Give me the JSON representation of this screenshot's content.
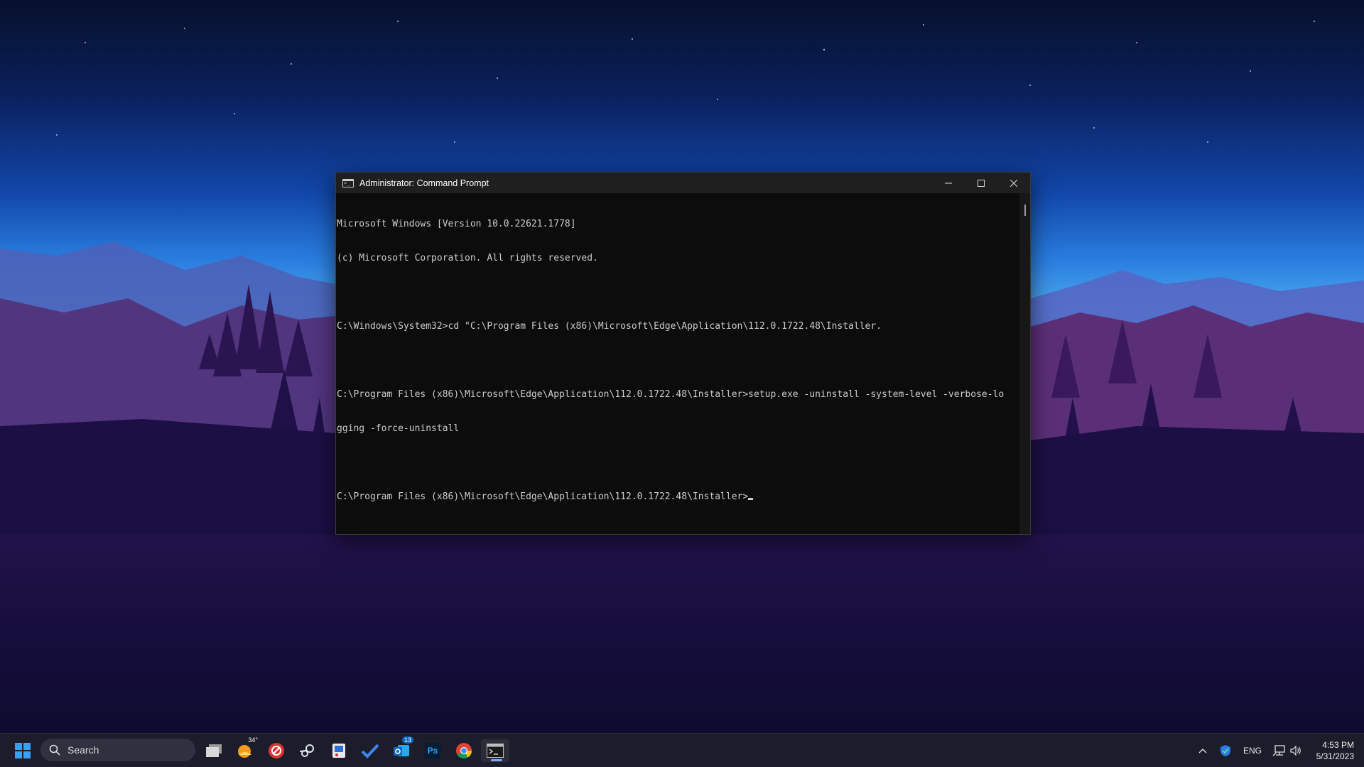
{
  "window": {
    "title": "Administrator: Command Prompt",
    "icon": "cmd-icon",
    "controls": {
      "minimize": "minimize-icon",
      "maximize": "maximize-icon",
      "close": "close-icon"
    }
  },
  "console": {
    "lines": [
      "Microsoft Windows [Version 10.0.22621.1778]",
      "(c) Microsoft Corporation. All rights reserved.",
      "",
      "C:\\Windows\\System32>cd \"C:\\Program Files (x86)\\Microsoft\\Edge\\Application\\112.0.1722.48\\Installer.",
      "",
      "C:\\Program Files (x86)\\Microsoft\\Edge\\Application\\112.0.1722.48\\Installer>setup.exe -uninstall -system-level -verbose-lo",
      "gging -force-uninstall",
      "",
      "C:\\Program Files (x86)\\Microsoft\\Edge\\Application\\112.0.1722.48\\Installer>"
    ]
  },
  "taskbar": {
    "search_label": "Search",
    "weather_badge": "34°",
    "mail_badge": "13",
    "apps": [
      {
        "name": "task-view-icon"
      },
      {
        "name": "weather-widget-icon"
      },
      {
        "name": "antivirus-app-icon"
      },
      {
        "name": "steam-icon"
      },
      {
        "name": "snipping-tool-icon"
      },
      {
        "name": "todo-icon"
      },
      {
        "name": "outlook-icon"
      },
      {
        "name": "photoshop-icon",
        "label": "Ps"
      },
      {
        "name": "chrome-icon"
      },
      {
        "name": "terminal-icon"
      }
    ],
    "tray": {
      "language": "ENG",
      "time": "4:53 PM",
      "date": "5/31/2023"
    }
  },
  "colors": {
    "console_bg": "#0c0c0c",
    "console_text": "#cccccc",
    "titlebar_bg": "#1f1f1f",
    "taskbar_bg": "#1c1c2a",
    "accent": "#7ea7ff"
  }
}
